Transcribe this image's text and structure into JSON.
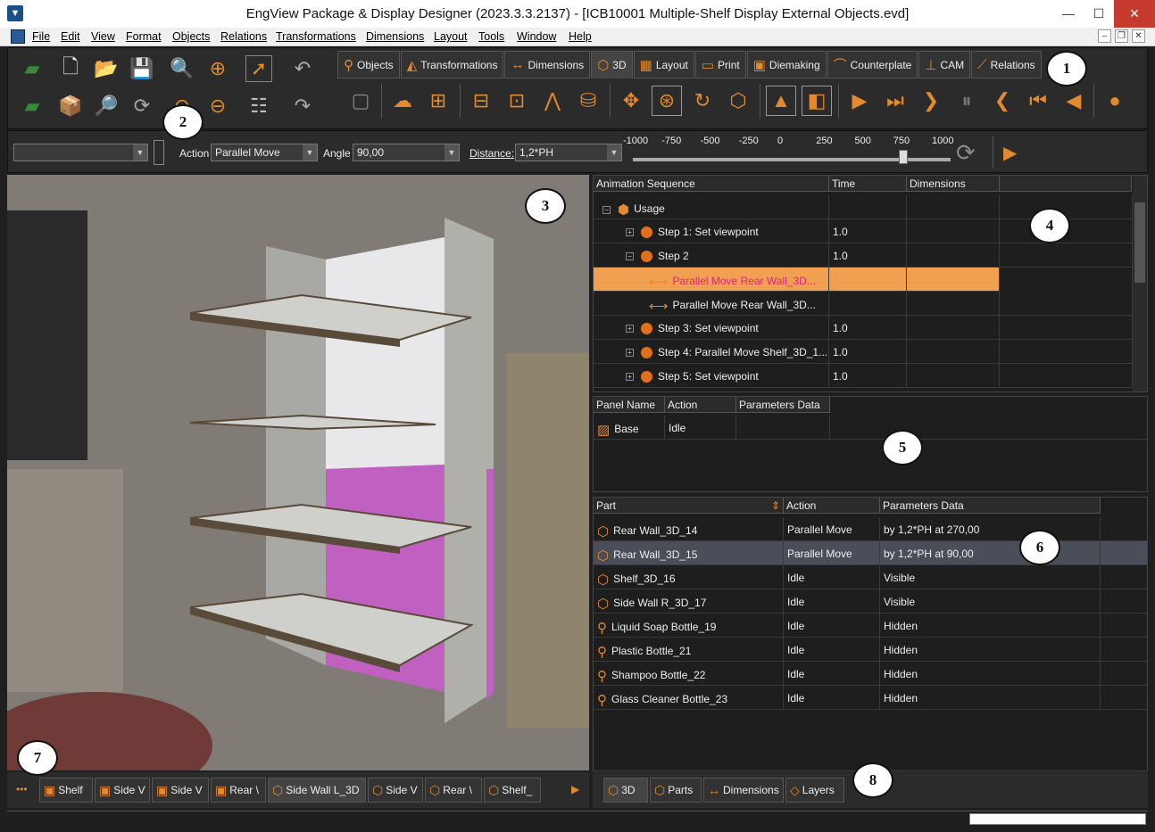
{
  "window": {
    "title": "EngView Package & Display Designer (2023.3.3.2137) - [ICB10001 Multiple-Shelf Display External Objects.evd]",
    "minimize": "—",
    "maximize": "☐",
    "close": "✕"
  },
  "menu": [
    "File",
    "Edit",
    "View",
    "Format",
    "Objects",
    "Relations",
    "Transformations",
    "Dimensions",
    "Layout",
    "Tools",
    "Window",
    "Help"
  ],
  "tabs": [
    "Objects",
    "Transformations",
    "Dimensions",
    "3D",
    "Layout",
    "Print",
    "Diemaking",
    "Counterplate",
    "CAM",
    "Relations"
  ],
  "active_tab": "3D",
  "props": {
    "action_label": "Action",
    "action_value": "Parallel Move",
    "angle_label": "Angle",
    "angle_value": "90,00",
    "distance_label": "Distance:",
    "distance_value": "1,2*PH",
    "scale": [
      "-1000",
      "-750",
      "-500",
      "-250",
      "0",
      "250",
      "500",
      "750",
      "1000"
    ],
    "slider_value": 750
  },
  "animation": {
    "headers": [
      "Animation Sequence",
      "Time",
      "Dimensions"
    ],
    "rows": [
      {
        "label": "Usage",
        "time": "",
        "level": 0,
        "type": "usage",
        "exp": "⊟"
      },
      {
        "label": "Step 1: Set viewpoint",
        "time": "1.0",
        "level": 1,
        "type": "step",
        "exp": "⊞"
      },
      {
        "label": "Step 2",
        "time": "1.0",
        "level": 1,
        "type": "step",
        "exp": "⊟"
      },
      {
        "label": "Parallel Move Rear Wall_3D...",
        "time": "",
        "level": 2,
        "type": "move",
        "selected": true
      },
      {
        "label": "Parallel Move Rear Wall_3D...",
        "time": "",
        "level": 2,
        "type": "move"
      },
      {
        "label": "Step 3: Set viewpoint",
        "time": "1.0",
        "level": 1,
        "type": "step",
        "exp": "⊞"
      },
      {
        "label": "Step 4: Parallel Move Shelf_3D_1...",
        "time": "1.0",
        "level": 1,
        "type": "step",
        "exp": "⊞"
      },
      {
        "label": "Step 5: Set viewpoint",
        "time": "1.0",
        "level": 1,
        "type": "step",
        "exp": "⊞"
      }
    ]
  },
  "panels": {
    "headers": [
      "Panel Name",
      "Action",
      "Parameters Data"
    ],
    "rows": [
      {
        "name": "Base",
        "action": "Idle",
        "params": ""
      }
    ]
  },
  "parts": {
    "headers": [
      "Part",
      "Action",
      "Parameters Data"
    ],
    "rows": [
      {
        "part": "Rear Wall_3D_14",
        "action": "Parallel Move",
        "params": "by 1,2*PH at 270,00",
        "icon": "box"
      },
      {
        "part": "Rear Wall_3D_15",
        "action": "Parallel Move",
        "params": "by 1,2*PH at 90,00",
        "icon": "box",
        "selected": true
      },
      {
        "part": "Shelf_3D_16",
        "action": "Idle",
        "params": "Visible",
        "icon": "box"
      },
      {
        "part": "Side Wall R_3D_17",
        "action": "Idle",
        "params": "Visible",
        "icon": "box"
      },
      {
        "part": "Liquid Soap Bottle_19",
        "action": "Idle",
        "params": "Hidden",
        "icon": "bottle"
      },
      {
        "part": "Plastic Bottle_21",
        "action": "Idle",
        "params": "Hidden",
        "icon": "bottle"
      },
      {
        "part": "Shampoo Bottle_22",
        "action": "Idle",
        "params": "Hidden",
        "icon": "bottle"
      },
      {
        "part": "Glass Cleaner Bottle_23",
        "action": "Idle",
        "params": "Hidden",
        "icon": "bottle"
      }
    ]
  },
  "bottom_tabs": [
    "Shelf",
    "Side V",
    "Side V",
    "Rear \\",
    "Side Wall L_3D",
    "Side V",
    "Rear \\",
    "Shelf_"
  ],
  "bottom_more": "•••",
  "right_tabs": [
    "3D",
    "Parts",
    "Dimensions",
    "Layers"
  ],
  "callouts": [
    "1",
    "2",
    "3",
    "4",
    "5",
    "6",
    "7",
    "8"
  ],
  "colors": {
    "accent": "#e58a2c",
    "selected_row": "#f0a050",
    "selected_text": "#e0208a",
    "magenta": "#c060c0"
  }
}
